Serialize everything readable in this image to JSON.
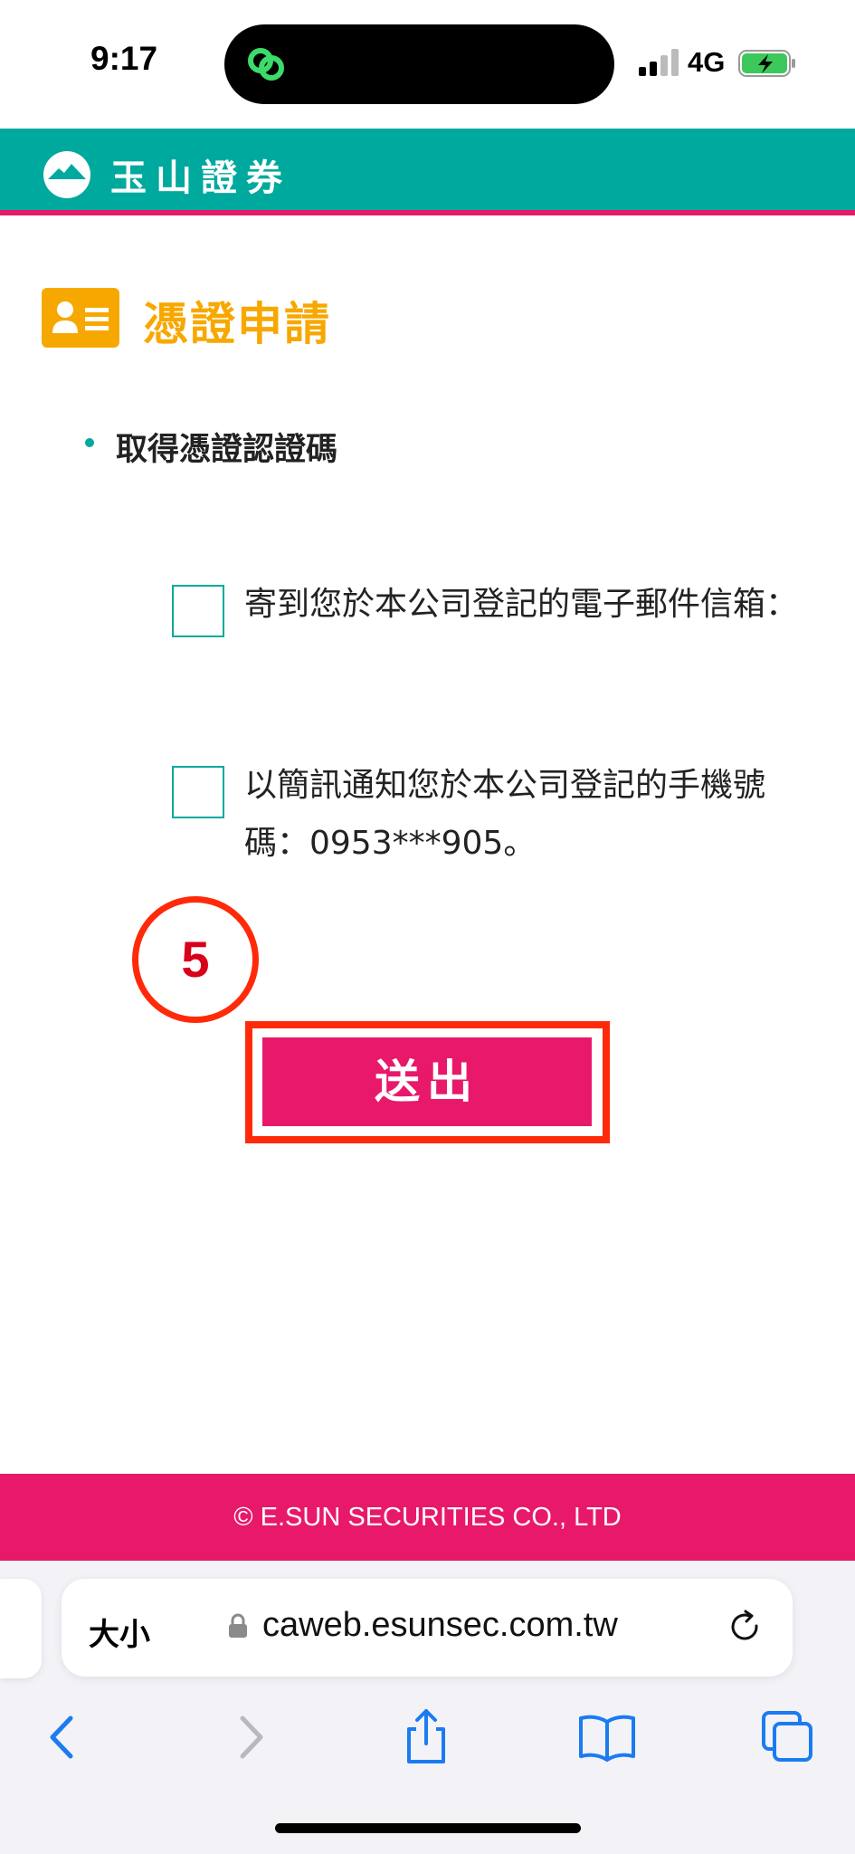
{
  "status_bar": {
    "time": "9:17",
    "network": "4G",
    "icons": [
      "app-indicator-icon",
      "signal-icon",
      "battery-charging-icon"
    ]
  },
  "header": {
    "brand_name": "玉山證券",
    "logo_icon": "esun-mountain-logo-icon",
    "colors": {
      "bar": "#00a99d",
      "accent_line": "#e8196a"
    }
  },
  "page": {
    "title": "憑證申請",
    "title_icon": "id-card-icon",
    "title_color": "#f7a800",
    "section_title": "取得憑證認證碼",
    "options": [
      {
        "label": "寄到您於本公司登記的電子郵件信箱：",
        "checked": false
      },
      {
        "label": "以簡訊通知您於本公司登記的手機號碼：0953***905。",
        "checked": false
      }
    ],
    "step_number": "5",
    "submit_label": "送出",
    "submit_color": "#e8196a",
    "annotation_color": "#ff2a0a"
  },
  "footer": {
    "copyright": "© E.SUN SECURITIES CO., LTD"
  },
  "browser": {
    "text_size_label": "大小",
    "url": "caweb.esunsec.com.tw",
    "toolbar_icons": [
      "back-icon",
      "forward-icon",
      "share-icon",
      "bookmarks-icon",
      "tabs-icon"
    ]
  }
}
